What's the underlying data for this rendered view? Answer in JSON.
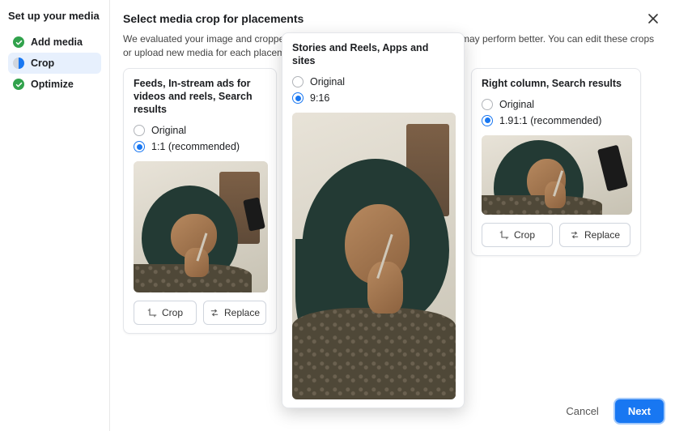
{
  "sidebar": {
    "title": "Set up your media",
    "steps": [
      {
        "label": "Add media"
      },
      {
        "label": "Crop"
      },
      {
        "label": "Optimize"
      }
    ]
  },
  "header": {
    "title": "Select media crop for placements"
  },
  "description": "We evaluated your image and cropped it to fill the placement where we think it may perform better. You can edit these crops or upload new media for each placement by hovering over the image.",
  "cards": {
    "feeds": {
      "title": "Feeds, In-stream ads for videos and reels, Search results",
      "opt_original": "Original",
      "opt_ratio": "1:1 (recommended)",
      "crop_label": "Crop",
      "replace_label": "Replace"
    },
    "stories": {
      "title": "Stories and Reels, Apps and sites",
      "opt_original": "Original",
      "opt_ratio": "9:16"
    },
    "right": {
      "title": "Right column, Search results",
      "opt_original": "Original",
      "opt_ratio": "1.91:1 (recommended)",
      "crop_label": "Crop",
      "replace_label": "Replace"
    }
  },
  "footer": {
    "cancel": "Cancel",
    "next": "Next"
  }
}
